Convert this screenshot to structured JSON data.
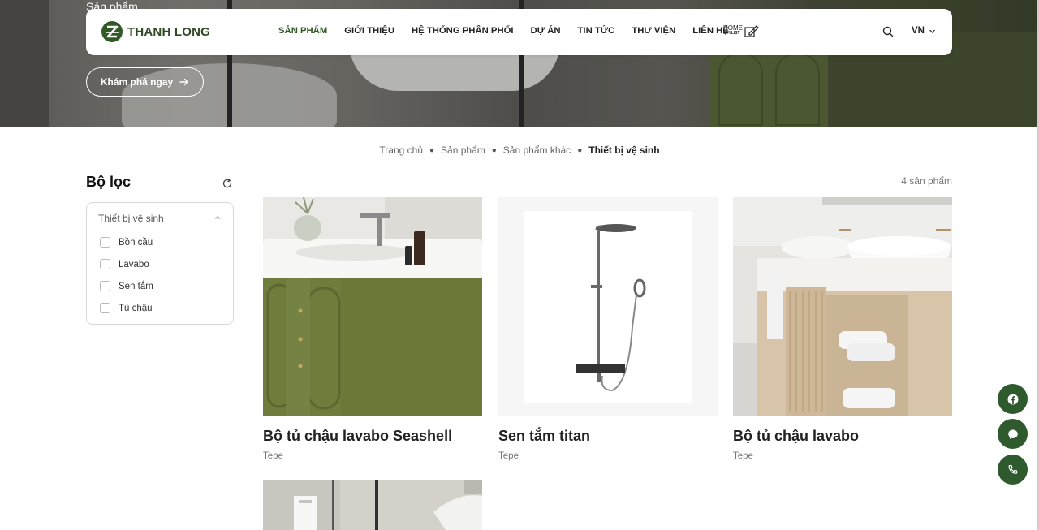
{
  "hero": {
    "title": "Sản phẩm",
    "explore_label": "Khám phá ngay"
  },
  "nav": {
    "logo_text": "THANH LONG",
    "menu": [
      {
        "label": "SẢN PHẨM",
        "active": true
      },
      {
        "label": "GIỚI THIỆU",
        "active": false
      },
      {
        "label": "HỆ THỐNG PHÂN PHỐI",
        "active": false
      },
      {
        "label": "DỰ ÁN",
        "active": false
      },
      {
        "label": "TIN TỨC",
        "active": false
      },
      {
        "label": "THƯ VIỆN",
        "active": false
      },
      {
        "label": "LIÊN HỆ",
        "active": false
      }
    ],
    "home_stylist_top": "HOME",
    "home_stylist_bottom": "STYLIST",
    "language": "VN"
  },
  "breadcrumb": [
    "Trang chủ",
    "Sản phẩm",
    "Sản phẩm khác",
    "Thiết bị vệ sinh"
  ],
  "filter": {
    "title": "Bộ lọc",
    "category": "Thiết bị vệ sinh",
    "options": [
      "Bồn cầu",
      "Lavabo",
      "Sen tắm",
      "Tủ chậu"
    ]
  },
  "products": {
    "count_label": "4 sản phẩm",
    "items": [
      {
        "name": "Bộ tủ chậu lavabo Seashell",
        "brand": "Tepe"
      },
      {
        "name": "Sen tắm titan",
        "brand": "Tepe"
      },
      {
        "name": "Bộ tủ chậu lavabo",
        "brand": "Tepe"
      },
      {
        "name": "",
        "brand": ""
      }
    ]
  },
  "colors": {
    "brand_green": "#2f5a25",
    "fab_green": "#2f5a2e"
  }
}
